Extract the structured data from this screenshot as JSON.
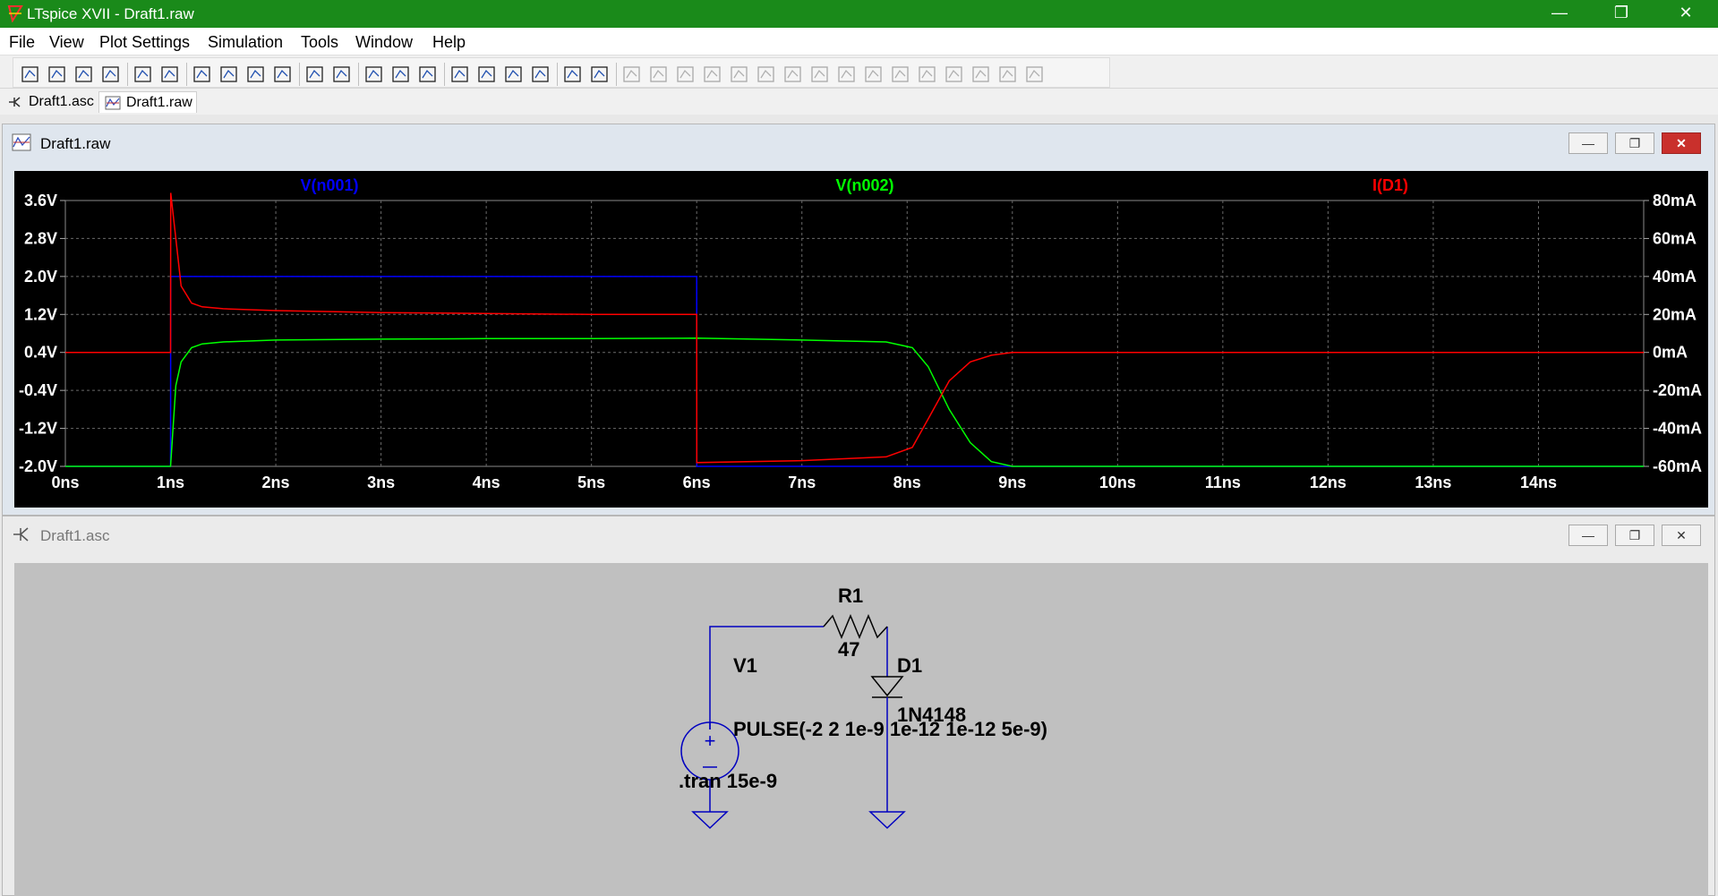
{
  "app": {
    "title": "LTspice XVII - Draft1.raw",
    "window_buttons": {
      "minimize": "—",
      "restore": "❐",
      "close": "✕"
    }
  },
  "menu": [
    "File",
    "View",
    "Plot Settings",
    "Simulation",
    "Tools",
    "Window",
    "Help"
  ],
  "toolbar": {
    "buttons": [
      "new-schematic-icon",
      "open-icon",
      "save-icon",
      "control-panel-icon",
      "run-icon",
      "pan-hand-icon",
      "zoom-in-icon",
      "zoom-out-icon",
      "zoom-area-icon",
      "zoom-fit-icon",
      "autorange-icon",
      "grid-icon",
      "tile-horizontal-icon",
      "cascade-icon",
      "tile-vertical-icon",
      "cut-icon",
      "copy-icon",
      "paste-icon",
      "find-icon",
      "print-icon",
      "print-setup-icon",
      "draw-wire-icon",
      "ground-icon",
      "label-net-icon",
      "resistor-icon",
      "capacitor-icon",
      "inductor-icon",
      "diode-icon",
      "component-icon",
      "move-icon",
      "drag-icon",
      "undo-icon",
      "redo-icon",
      "rotate-icon",
      "mirror-icon",
      "text-icon",
      "spice-directive-icon"
    ]
  },
  "tabs": [
    {
      "label": "Draft1.asc",
      "active": false
    },
    {
      "label": "Draft1.raw",
      "active": true
    }
  ],
  "plot_window": {
    "title": "Draft1.raw",
    "traces": [
      {
        "label": "V(n001)",
        "color": "#0000ff"
      },
      {
        "label": "V(n002)",
        "color": "#00ff00"
      },
      {
        "label": "I(D1)",
        "color": "#ff0000"
      }
    ]
  },
  "chart_data": {
    "type": "line",
    "x_unit": "ns",
    "xlim": [
      0,
      15
    ],
    "x_ticks": [
      "0ns",
      "1ns",
      "2ns",
      "3ns",
      "4ns",
      "5ns",
      "6ns",
      "7ns",
      "8ns",
      "9ns",
      "10ns",
      "11ns",
      "12ns",
      "13ns",
      "14ns"
    ],
    "y_left_ticks": [
      "3.6V",
      "2.8V",
      "2.0V",
      "1.2V",
      "0.4V",
      "-0.4V",
      "-1.2V",
      "-2.0V"
    ],
    "y_left_lim": [
      -2.0,
      3.6
    ],
    "y_right_ticks": [
      "80mA",
      "60mA",
      "40mA",
      "20mA",
      "0mA",
      "-20mA",
      "-40mA",
      "-60mA"
    ],
    "y_right_lim": [
      -60,
      80
    ],
    "grid": true,
    "series": [
      {
        "name": "V(n001)",
        "axis": "left",
        "color": "#0000ff",
        "x": [
          0,
          1.0,
          1.001,
          6.0,
          6.001,
          15
        ],
        "y": [
          -2.0,
          -2.0,
          2.0,
          2.0,
          -2.0,
          -2.0
        ]
      },
      {
        "name": "V(n002)",
        "axis": "left",
        "color": "#00ff00",
        "x": [
          0,
          1.0,
          1.05,
          1.1,
          1.2,
          1.3,
          1.5,
          2,
          3,
          4,
          5,
          6,
          7,
          7.8,
          8.05,
          8.2,
          8.4,
          8.6,
          8.8,
          9.0,
          15
        ],
        "y": [
          -2.0,
          -2.0,
          -0.3,
          0.2,
          0.5,
          0.58,
          0.62,
          0.66,
          0.68,
          0.69,
          0.69,
          0.7,
          0.66,
          0.62,
          0.5,
          0.1,
          -0.8,
          -1.5,
          -1.9,
          -2.0,
          -2.0
        ]
      },
      {
        "name": "I(D1)",
        "axis": "right",
        "color": "#ff0000",
        "x": [
          0,
          1.0,
          1.001,
          1.05,
          1.1,
          1.2,
          1.3,
          1.5,
          2,
          3,
          4,
          5,
          6.0,
          6.001,
          7,
          7.8,
          8.05,
          8.2,
          8.4,
          8.6,
          8.8,
          9.0,
          15
        ],
        "y": [
          0,
          0,
          84,
          60,
          35,
          26,
          24,
          23,
          22,
          21,
          20.5,
          20,
          20,
          -58,
          -57,
          -55,
          -50,
          -35,
          -15,
          -5,
          -1.5,
          0,
          0
        ]
      }
    ]
  },
  "schematic_window": {
    "title": "Draft1.asc",
    "components": {
      "r1_name": "R1",
      "r1_value": "47",
      "d1_name": "D1",
      "d1_value": "1N4148",
      "v1_name": "V1",
      "v1_value": "PULSE(-2 2 1e-9 1e-12 1e-12 5e-9)",
      "directive": ".tran 15e-9"
    }
  }
}
